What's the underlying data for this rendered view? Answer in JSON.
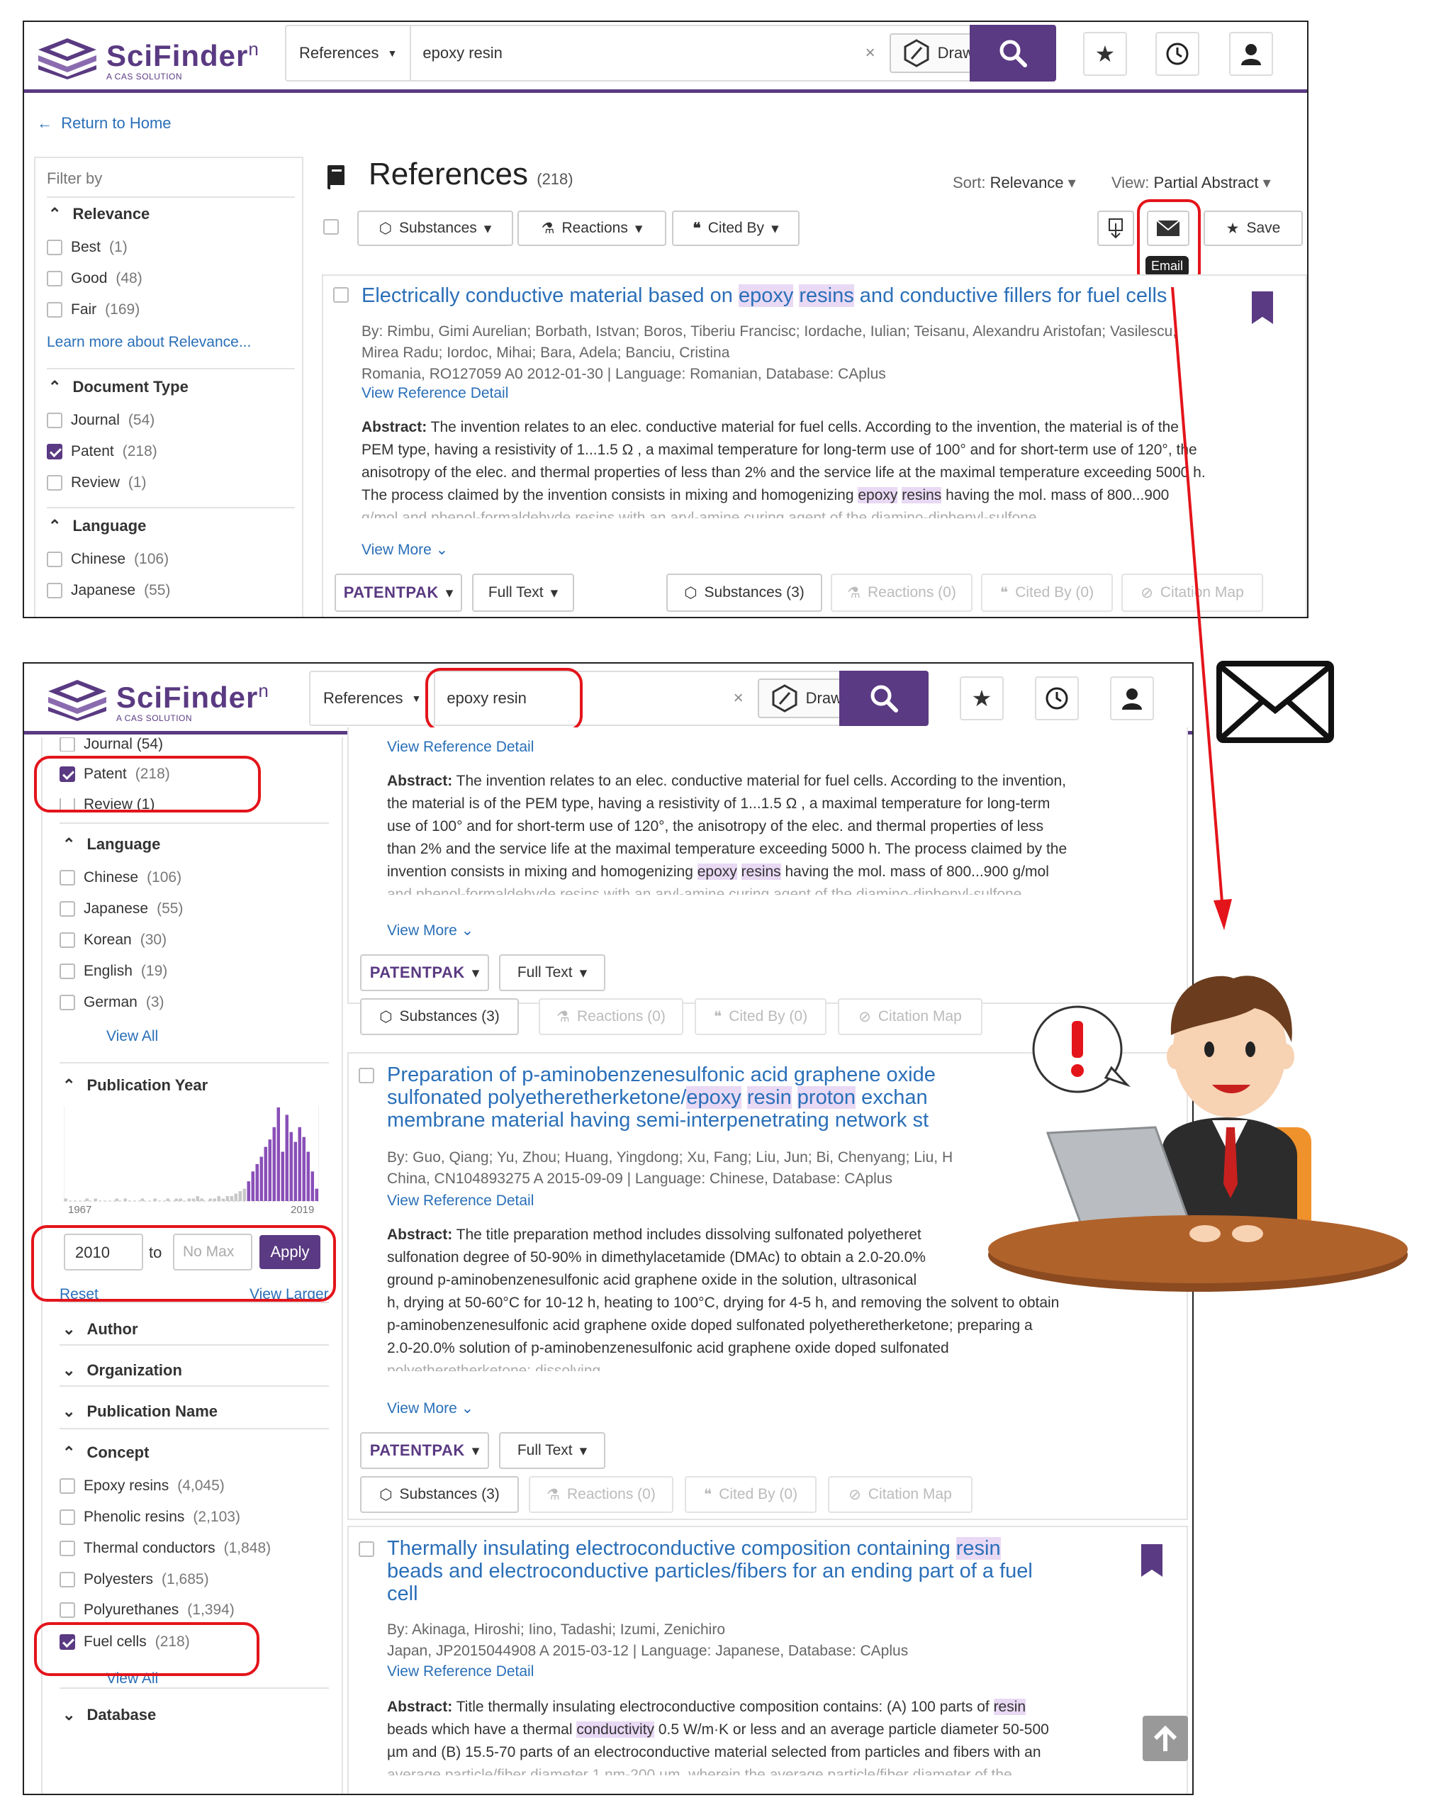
{
  "app": {
    "name": "SciFinder",
    "superscript": "n",
    "tagline": "A CAS SOLUTION"
  },
  "search": {
    "type": "References",
    "query": "epoxy resin",
    "clear": "×",
    "draw_label": "Draw"
  },
  "top": {
    "return_home": "Return to Home",
    "filter_by": "Filter by",
    "relevance": {
      "title": "Relevance",
      "items": [
        {
          "label": "Best",
          "count": "(1)"
        },
        {
          "label": "Good",
          "count": "(48)"
        },
        {
          "label": "Fair",
          "count": "(169)"
        }
      ],
      "learn_more": "Learn more about Relevance..."
    },
    "doctype": {
      "title": "Document Type",
      "items": [
        {
          "label": "Journal",
          "count": "(54)"
        },
        {
          "label": "Patent",
          "count": "(218)"
        },
        {
          "label": "Review",
          "count": "(1)"
        }
      ]
    },
    "language": {
      "title": "Language",
      "items": [
        {
          "label": "Chinese",
          "count": "(106)"
        },
        {
          "label": "Japanese",
          "count": "(55)"
        }
      ]
    },
    "results": {
      "heading": "References",
      "count": "(218)",
      "sort_label": "Sort:",
      "sort_value": "Relevance",
      "view_label": "View:",
      "view_value": "Partial Abstract",
      "substances": "Substances",
      "reactions": "Reactions",
      "cited_by": "Cited By",
      "save": "Save",
      "email_tooltip": "Email"
    },
    "card": {
      "title_parts": [
        "Electrically conductive material based on ",
        "epoxy",
        " ",
        "resins",
        " and conductive fillers for fuel cells"
      ],
      "authors_1": "By: Rimbu, Gimi Aurelian; Borbath, Istvan; Boros, Tiberiu Francisc; Iordache, Iulian; Teisanu, Alexandru Aristofan; Vasilescu,",
      "authors_2": "Mirea Radu; Iordoc, Mihai; Bara, Adela; Banciu, Cristina",
      "source": "Romania, RO127059 A0 2012-01-30 | Language: Romanian, Database: CAplus",
      "view_detail": "View Reference Detail",
      "abstract_label": "Abstract:",
      "abstract_1": " The invention relates to an elec. conductive material for fuel cells. According to the invention, the material is of the",
      "abstract_2": "PEM type, having a resistivity of 1...1.5 Ω , a maximal temperature for long-term use of 100° and for short-term use of 120°, the",
      "abstract_3": "anisotropy of the elec. and thermal properties of less than 2% and the service life at the maximal temperature exceeding 5000 h.",
      "abstract_4a": "The process claimed by the invention consists in mixing and homogenizing ",
      "abstract_4hl1": "epoxy",
      "abstract_4hl2": "resins",
      "abstract_4b": " having the mol. mass of 800...900",
      "abstract_5": "g/mol and phenol-formaldehyde resins with an aryl-amine curing agent of the diamino-diphenyl-sulfone",
      "view_more": "View More",
      "patentpak": "PATENTPAK",
      "full_text": "Full Text",
      "substances": "Substances (3)",
      "reactions": "Reactions (0)",
      "cited_by": "Cited By (0)",
      "citation_map": "Citation Map"
    }
  },
  "bottom": {
    "filters": {
      "journal": "Journal (54)",
      "patent_label": "Patent",
      "patent_count": "(218)",
      "review": "Review (1)",
      "language_title": "Language",
      "languages": [
        {
          "label": "Chinese",
          "count": "(106)"
        },
        {
          "label": "Japanese",
          "count": "(55)"
        },
        {
          "label": "Korean",
          "count": "(30)"
        },
        {
          "label": "English",
          "count": "(19)"
        },
        {
          "label": "German",
          "count": "(3)"
        }
      ],
      "view_all": "View All",
      "pubyear_title": "Publication Year",
      "year_min_label": "1967",
      "year_max_label": "2019",
      "year_from": "2010",
      "to_label": "to",
      "year_to_placeholder": "No Max",
      "apply": "Apply",
      "reset": "Reset",
      "view_larger": "View Larger",
      "author": "Author",
      "organization": "Organization",
      "pubname": "Publication Name",
      "concept_title": "Concept",
      "concepts": [
        {
          "label": "Epoxy resins",
          "count": "(4,045)"
        },
        {
          "label": "Phenolic resins",
          "count": "(2,103)"
        },
        {
          "label": "Thermal conductors",
          "count": "(1,848)"
        },
        {
          "label": "Polyesters",
          "count": "(1,685)"
        },
        {
          "label": "Polyurethanes",
          "count": "(1,394)"
        }
      ],
      "fuel_cells_label": "Fuel cells",
      "fuel_cells_count": "(218)",
      "concept_view_all": "View All",
      "database": "Database"
    },
    "card1": {
      "view_detail": "View Reference Detail",
      "abstract_label": "Abstract:",
      "a1": " The invention relates to an elec. conductive material for fuel cells. According to the invention,",
      "a2": "the material is of the PEM type, having a resistivity of 1...1.5 Ω , a maximal temperature for long-term",
      "a3": "use of 100° and for short-term use of 120°, the anisotropy of the elec. and thermal properties of less",
      "a4": "than 2% and the service life at the maximal temperature exceeding 5000 h. The process claimed by the",
      "a5a": "invention consists in mixing and homogenizing ",
      "a5hl1": "epoxy",
      "a5hl2": "resins",
      "a5b": " having the mol. mass of 800...900 g/mol",
      "a6": "and phenol-formaldehyde resins with an aryl-amine curing agent of the diamino-diphenyl-sulfone",
      "view_more": "View More",
      "patentpak": "PATENTPAK",
      "full_text": "Full Text",
      "substances": "Substances (3)",
      "reactions": "Reactions (0)",
      "cited_by": "Cited By (0)",
      "citation_map": "Citation Map"
    },
    "card2": {
      "t1": "Preparation of p-aminobenzenesulfonic acid graphene oxide",
      "t2a": "sulfonated polyetheretherketone/",
      "t2hl1": "epoxy",
      "t2hl2": "resin",
      "t2hl3": "proton",
      "t2b": " exchan",
      "t3": "membrane material having semi-interpenetrating network st",
      "authors": "By: Guo, Qiang; Yu, Zhou; Huang, Yingdong; Xu, Fang; Liu, Jun; Bi, Chenyang; Liu, H",
      "source": "China, CN104893275 A 2015-09-09 | Language: Chinese, Database: CAplus",
      "view_detail": "View Reference Detail",
      "abstract_label": "Abstract:",
      "a1": " The title preparation method includes dissolving sulfonated polyetheret",
      "a2": "sulfonation degree of 50-90% in dimethylacetamide (DMAc) to obtain a 2.0-20.0%",
      "a3": "ground p-aminobenzenesulfonic acid graphene oxide in the solution, ultrasonical",
      "a4": "h, drying at 50-60°C for 10-12 h, heating to 100°C, drying for 4-5 h, and removing the solvent to obtain",
      "a5": "p-aminobenzenesulfonic acid graphene oxide doped sulfonated polyetheretherketone; preparing a",
      "a6": "2.0-20.0% solution of p-aminobenzenesulfonic acid graphene oxide doped sulfonated",
      "a7": "polyetheretherketone; dissolving",
      "view_more": "View More",
      "patentpak": "PATENTPAK",
      "full_text": "Full Text",
      "substances": "Substances (3)",
      "reactions": "Reactions (0)",
      "cited_by": "Cited By (0)",
      "citation_map": "Citation Map"
    },
    "card3": {
      "t1a": "Thermally insulating electroconductive composition containing ",
      "t1hl": "resin",
      "t2": "beads and electroconductive particles/fibers for an ending part of a fuel",
      "t3": "cell",
      "authors": "By: Akinaga, Hiroshi; Iino, Tadashi; Izumi, Zenichiro",
      "source": "Japan, JP2015044908 A 2015-03-12 | Language: Japanese, Database: CAplus",
      "view_detail": "View Reference Detail",
      "abstract_label": "Abstract:",
      "a1a": " Title thermally insulating electroconductive composition contains: (A) 100 parts of ",
      "a1hl": "resin",
      "a2a": "beads which have a thermal ",
      "a2hl": "conductivity",
      "a2b": " 0.5 W/m·K or less and an average particle diameter 50-500",
      "a3": "µm and (B) 15.5-70 parts of an electroconductive material selected from particles and fibers with an",
      "a4": "average particle/fiber diameter 1 nm-200 µm, wherein the average particle/fiber diameter of the"
    }
  },
  "histogram": {
    "counts": [
      1,
      0,
      0,
      0,
      0,
      1,
      0,
      1,
      0,
      0,
      0,
      0,
      1,
      0,
      1,
      0,
      0,
      0,
      1,
      0,
      0,
      1,
      0,
      0,
      1,
      0,
      1,
      1,
      0,
      1,
      1,
      2,
      1,
      0,
      1,
      1,
      2,
      1,
      2,
      2,
      3,
      4,
      5,
      8,
      12,
      15,
      18,
      22,
      25,
      30,
      38,
      20,
      35,
      28,
      24,
      30,
      26,
      20,
      12,
      5
    ],
    "selected_from_index": 43
  },
  "colors": {
    "brand": "#5a3a82",
    "link": "#2a6fb8",
    "highlight": "#e9d9f4",
    "callout": "#e4141b"
  }
}
